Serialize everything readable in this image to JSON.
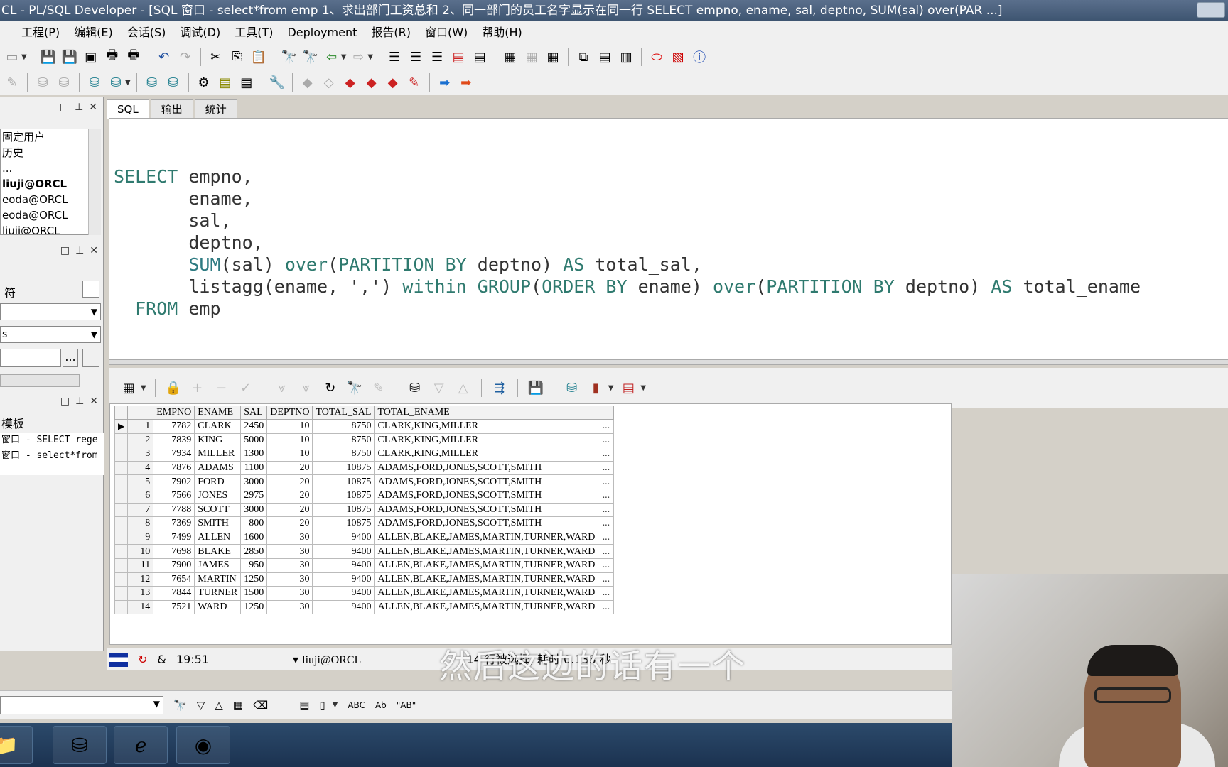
{
  "window": {
    "title": "CL - PL/SQL Developer - [SQL 窗口 - select*from emp 1、求出部门工资总和 2、同一部门的员工名字显示在同一行 SELECT empno, ename, sal, deptno, SUM(sal) over(PAR ...]"
  },
  "menu": [
    "工程(P)",
    "编辑(E)",
    "会话(S)",
    "调试(D)",
    "工具(T)",
    "Deployment",
    "报告(R)",
    "窗口(W)",
    "帮助(H)"
  ],
  "left": {
    "tree_items": [
      "固定用户",
      "历史",
      "...",
      "liuji@ORCL",
      "eoda@ORCL",
      "eoda@ORCL",
      "liuji@ORCL"
    ],
    "tool_labels": [
      "s",
      "符"
    ],
    "templates": {
      "header": "模板",
      "items": [
        "窗口 - SELECT rege",
        "窗口 - select*from"
      ]
    },
    "more_button": "..."
  },
  "tabs": [
    "SQL",
    "输出",
    "统计"
  ],
  "sql": {
    "lines": [
      [
        {
          "t": "SELECT",
          "c": "kw"
        },
        {
          "t": " empno,",
          "c": ""
        }
      ],
      [
        {
          "t": "       ename,",
          "c": ""
        }
      ],
      [
        {
          "t": "       sal,",
          "c": ""
        }
      ],
      [
        {
          "t": "       deptno,",
          "c": ""
        }
      ],
      [
        {
          "t": "       ",
          "c": ""
        },
        {
          "t": "SUM",
          "c": "fn"
        },
        {
          "t": "(sal) ",
          "c": ""
        },
        {
          "t": "over",
          "c": "kw"
        },
        {
          "t": "(",
          "c": ""
        },
        {
          "t": "PARTITION BY",
          "c": "kw"
        },
        {
          "t": " deptno) ",
          "c": ""
        },
        {
          "t": "AS",
          "c": "kw"
        },
        {
          "t": " total_sal,",
          "c": ""
        }
      ],
      [
        {
          "t": "       listagg(ename, ',') ",
          "c": ""
        },
        {
          "t": "within",
          "c": "kw"
        },
        {
          "t": " ",
          "c": ""
        },
        {
          "t": "GROUP",
          "c": "kw"
        },
        {
          "t": "(",
          "c": ""
        },
        {
          "t": "ORDER BY",
          "c": "kw"
        },
        {
          "t": " ename) ",
          "c": ""
        },
        {
          "t": "over",
          "c": "kw"
        },
        {
          "t": "(",
          "c": ""
        },
        {
          "t": "PARTITION BY",
          "c": "kw"
        },
        {
          "t": " deptno) ",
          "c": ""
        },
        {
          "t": "AS",
          "c": "kw"
        },
        {
          "t": " total_ename",
          "c": ""
        }
      ],
      [
        {
          "t": "  ",
          "c": ""
        },
        {
          "t": "FROM",
          "c": "kw"
        },
        {
          "t": " emp",
          "c": ""
        }
      ]
    ]
  },
  "grid": {
    "columns": [
      "EMPNO",
      "ENAME",
      "SAL",
      "DEPTNO",
      "TOTAL_SAL",
      "TOTAL_ENAME"
    ],
    "more": "...",
    "rows": [
      [
        "1",
        "7782",
        "CLARK",
        "2450",
        "10",
        "8750",
        "CLARK,KING,MILLER"
      ],
      [
        "2",
        "7839",
        "KING",
        "5000",
        "10",
        "8750",
        "CLARK,KING,MILLER"
      ],
      [
        "3",
        "7934",
        "MILLER",
        "1300",
        "10",
        "8750",
        "CLARK,KING,MILLER"
      ],
      [
        "4",
        "7876",
        "ADAMS",
        "1100",
        "20",
        "10875",
        "ADAMS,FORD,JONES,SCOTT,SMITH"
      ],
      [
        "5",
        "7902",
        "FORD",
        "3000",
        "20",
        "10875",
        "ADAMS,FORD,JONES,SCOTT,SMITH"
      ],
      [
        "6",
        "7566",
        "JONES",
        "2975",
        "20",
        "10875",
        "ADAMS,FORD,JONES,SCOTT,SMITH"
      ],
      [
        "7",
        "7788",
        "SCOTT",
        "3000",
        "20",
        "10875",
        "ADAMS,FORD,JONES,SCOTT,SMITH"
      ],
      [
        "8",
        "7369",
        "SMITH",
        "800",
        "20",
        "10875",
        "ADAMS,FORD,JONES,SCOTT,SMITH"
      ],
      [
        "9",
        "7499",
        "ALLEN",
        "1600",
        "30",
        "9400",
        "ALLEN,BLAKE,JAMES,MARTIN,TURNER,WARD"
      ],
      [
        "10",
        "7698",
        "BLAKE",
        "2850",
        "30",
        "9400",
        "ALLEN,BLAKE,JAMES,MARTIN,TURNER,WARD"
      ],
      [
        "11",
        "7900",
        "JAMES",
        "950",
        "30",
        "9400",
        "ALLEN,BLAKE,JAMES,MARTIN,TURNER,WARD"
      ],
      [
        "12",
        "7654",
        "MARTIN",
        "1250",
        "30",
        "9400",
        "ALLEN,BLAKE,JAMES,MARTIN,TURNER,WARD"
      ],
      [
        "13",
        "7844",
        "TURNER",
        "1500",
        "30",
        "9400",
        "ALLEN,BLAKE,JAMES,MARTIN,TURNER,WARD"
      ],
      [
        "14",
        "7521",
        "WARD",
        "1250",
        "30",
        "9400",
        "ALLEN,BLAKE,JAMES,MARTIN,TURNER,WARD"
      ]
    ]
  },
  "status": {
    "symbol": "&",
    "position": "19:51",
    "connection": "liuji@ORCL",
    "message": "14 行被选择, 耗时 0.133 秒"
  },
  "subtitle": "然后这边的话有一个",
  "findbar": {
    "labels": [
      "ABC",
      "Ab",
      "\"AB\""
    ]
  }
}
